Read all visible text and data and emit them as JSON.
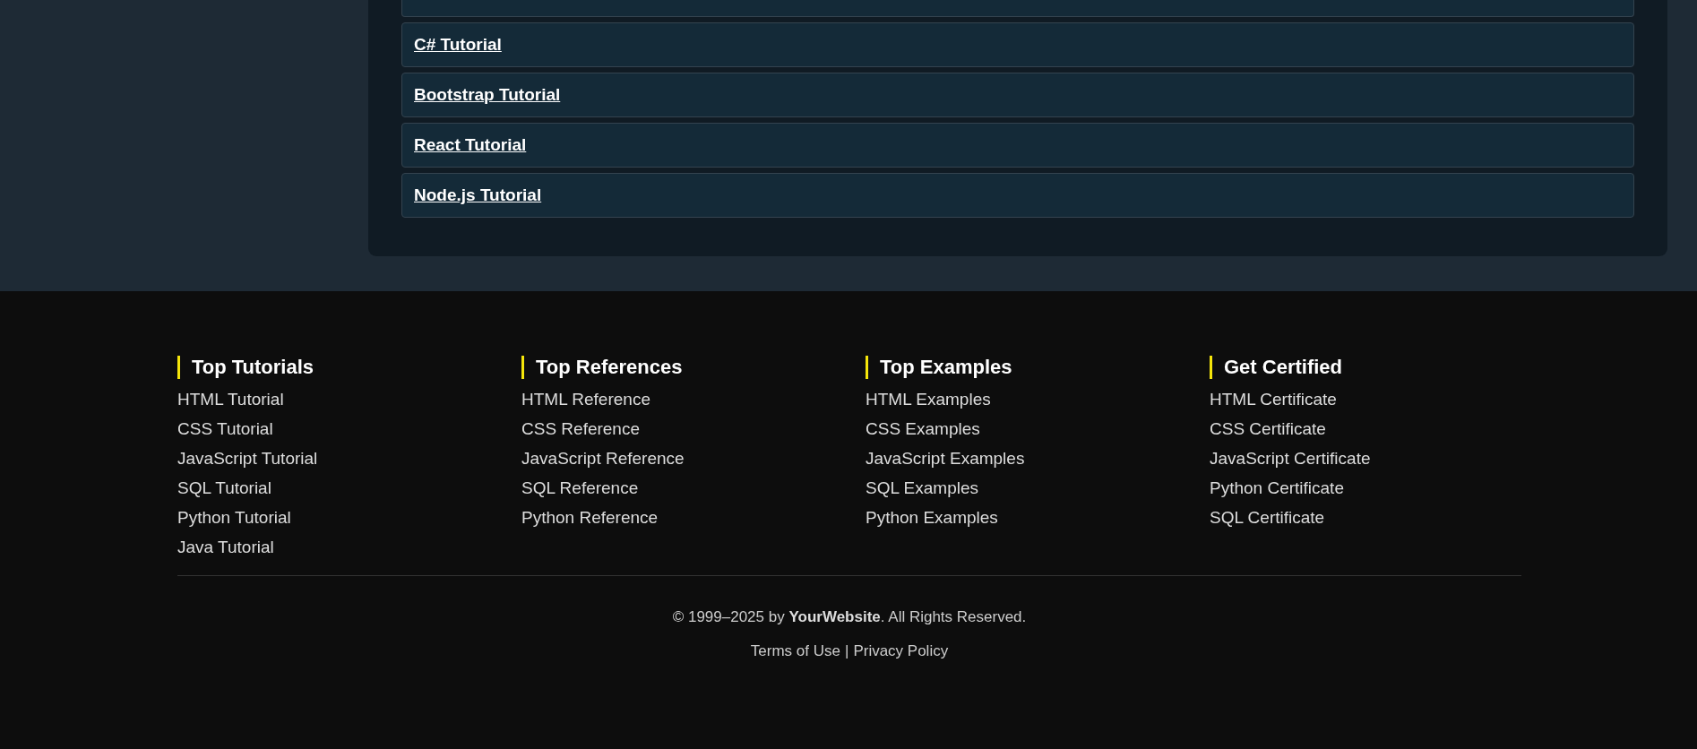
{
  "tutorial_list": {
    "items": [
      {
        "label": "C# Tutorial"
      },
      {
        "label": "Bootstrap Tutorial"
      },
      {
        "label": "React Tutorial"
      },
      {
        "label": "Node.js Tutorial"
      }
    ]
  },
  "footer": {
    "columns": [
      {
        "heading": "Top Tutorials",
        "links": [
          "HTML Tutorial",
          "CSS Tutorial",
          "JavaScript Tutorial",
          "SQL Tutorial",
          "Python Tutorial",
          "Java Tutorial"
        ]
      },
      {
        "heading": "Top References",
        "links": [
          "HTML Reference",
          "CSS Reference",
          "JavaScript Reference",
          "SQL Reference",
          "Python Reference"
        ]
      },
      {
        "heading": "Top Examples",
        "links": [
          "HTML Examples",
          "CSS Examples",
          "JavaScript Examples",
          "SQL Examples",
          "Python Examples"
        ]
      },
      {
        "heading": "Get Certified",
        "links": [
          "HTML Certificate",
          "CSS Certificate",
          "JavaScript Certificate",
          "Python Certificate",
          "SQL Certificate"
        ]
      }
    ],
    "copyright": "© 1999–2025 by **YourWebsite**. All Rights Reserved.",
    "legal_links": [
      {
        "label": "Terms of Use"
      },
      {
        "label": "Privacy Policy"
      }
    ],
    "separator": "|"
  }
}
